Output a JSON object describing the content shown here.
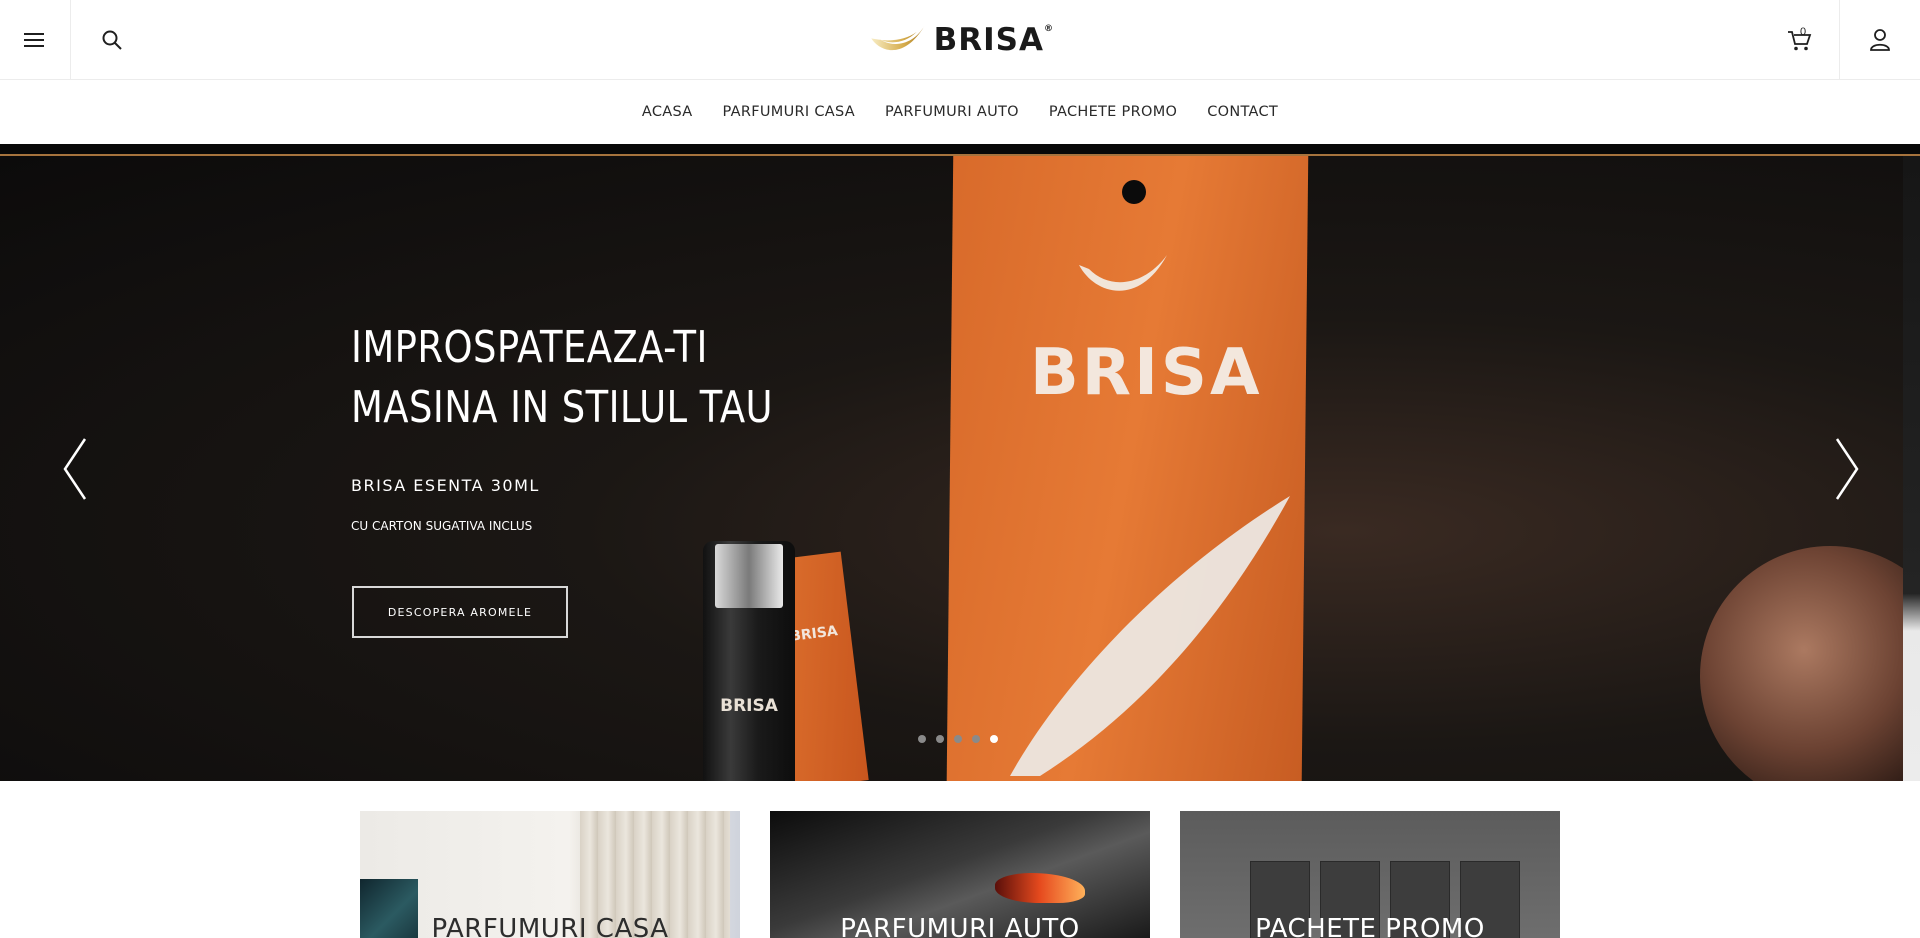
{
  "header": {
    "brand": "BRISA",
    "brand_mark": "®",
    "cart_count": "0",
    "icons": [
      "hamburger-menu-icon",
      "search-icon",
      "cart-icon",
      "user-icon"
    ]
  },
  "nav": {
    "items": [
      "ACASA",
      "PARFUMURI CASA",
      "PARFUMURI AUTO",
      "PACHETE PROMO",
      "CONTACT"
    ]
  },
  "hero": {
    "title_line1": "IMPROSPATEAZA-TI",
    "title_line2": "MASINA IN STILUL TAU",
    "subtitle": "BRISA ESENTA 30ML",
    "small_text": "CU CARTON SUGATIVA INCLUS",
    "button_label": "DESCOPERA AROMELE",
    "tag_brand": "BRISA",
    "bottle_brand": "BRISA",
    "small_tag_brand": "BRISA",
    "slides_total": 5,
    "active_slide": 5,
    "colors": {
      "accent_bar": "#a6733d",
      "tag_orange": "#e67a35"
    }
  },
  "categories": [
    {
      "label": "PARFUMURI CASA"
    },
    {
      "label": "PARFUMURI AUTO"
    },
    {
      "label": "PACHETE PROMO"
    }
  ]
}
